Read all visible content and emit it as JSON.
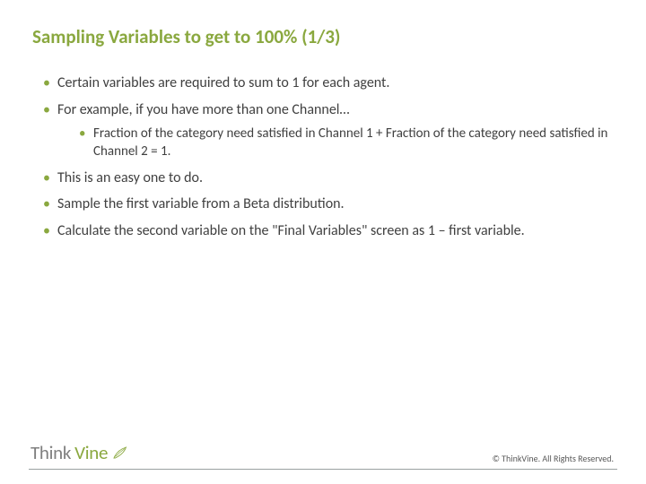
{
  "title": "Sampling Variables to get to 100% (1/3)",
  "bullets": {
    "b0": "Certain variables are required to sum to 1 for each agent.",
    "b1": "For example, if you have more than one Channel…",
    "b1_sub0": "Fraction of the category need  satisfied in Channel 1 + Fraction of the category need  satisfied in Channel  2 = 1.",
    "b2": "This is an easy one to do.",
    "b3": "Sample the first variable from a Beta distribution.",
    "b4": "Calculate the second variable on the \"Final Variables\" screen as 1 – first variable."
  },
  "logo": {
    "part1": "Think",
    "part2": "Vine"
  },
  "copyright": "© ThinkVine.  All Rights Reserved."
}
